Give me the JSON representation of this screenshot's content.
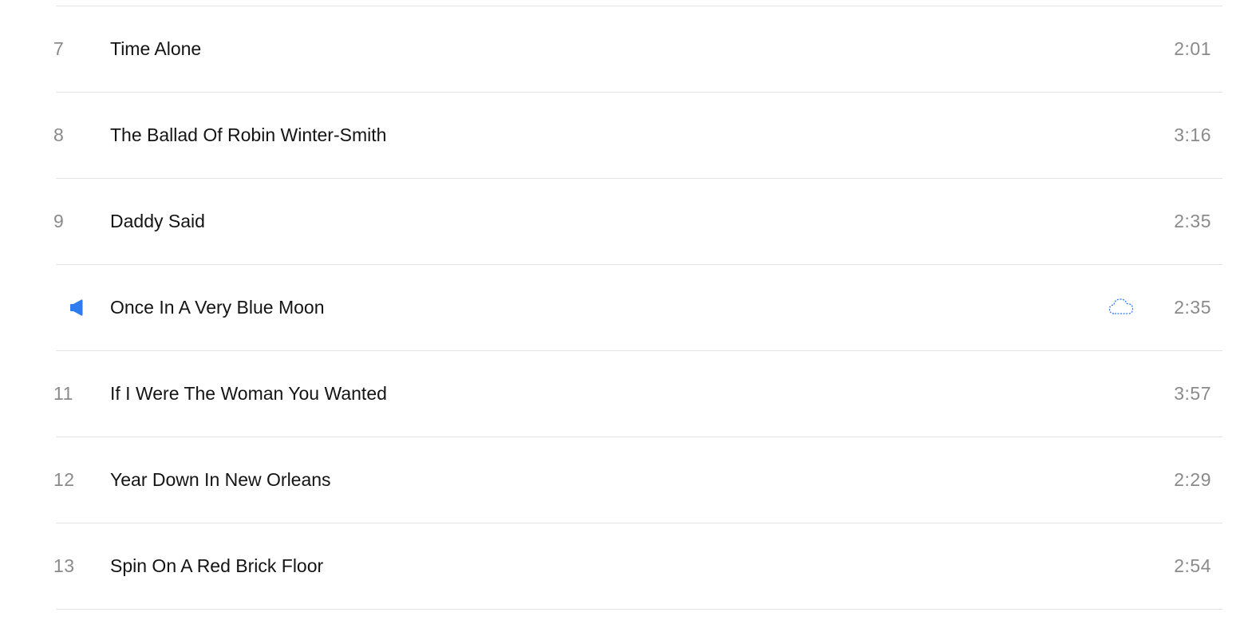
{
  "tracks": [
    {
      "number": "7",
      "title": "Time Alone",
      "duration": "2:01"
    },
    {
      "number": "8",
      "title": "The Ballad Of Robin Winter-Smith",
      "duration": "3:16"
    },
    {
      "number": "9",
      "title": "Daddy Said",
      "duration": "2:35"
    },
    {
      "number": "",
      "title": "Once In A Very Blue Moon",
      "duration": "2:35",
      "now_playing_icon": "speaker-icon",
      "status_icon": "cloud-download-icon"
    },
    {
      "number": "11",
      "title": "If I Were The Woman You Wanted",
      "duration": "3:57"
    },
    {
      "number": "12",
      "title": "Year Down In New Orleans",
      "duration": "2:29"
    },
    {
      "number": "13",
      "title": "Spin On A Red Brick Floor",
      "duration": "2:54"
    }
  ],
  "colors": {
    "accent": "#2f7bf0",
    "text_primary": "#141414",
    "text_secondary": "#8a8a8a",
    "divider": "#e3e3e3"
  }
}
